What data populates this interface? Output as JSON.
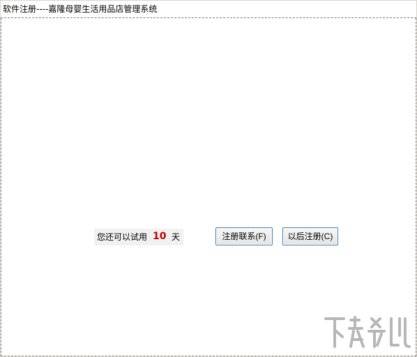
{
  "window": {
    "title": "软件注册----嘉隆母婴生活用品店管理系统"
  },
  "trial": {
    "prefix": "您还可以试用",
    "days": "10",
    "suffix": "天"
  },
  "buttons": {
    "register_contact": "注册联系(F)",
    "register_later": "以后注册(C)"
  },
  "watermark": {
    "icon": "download-site-logo"
  }
}
